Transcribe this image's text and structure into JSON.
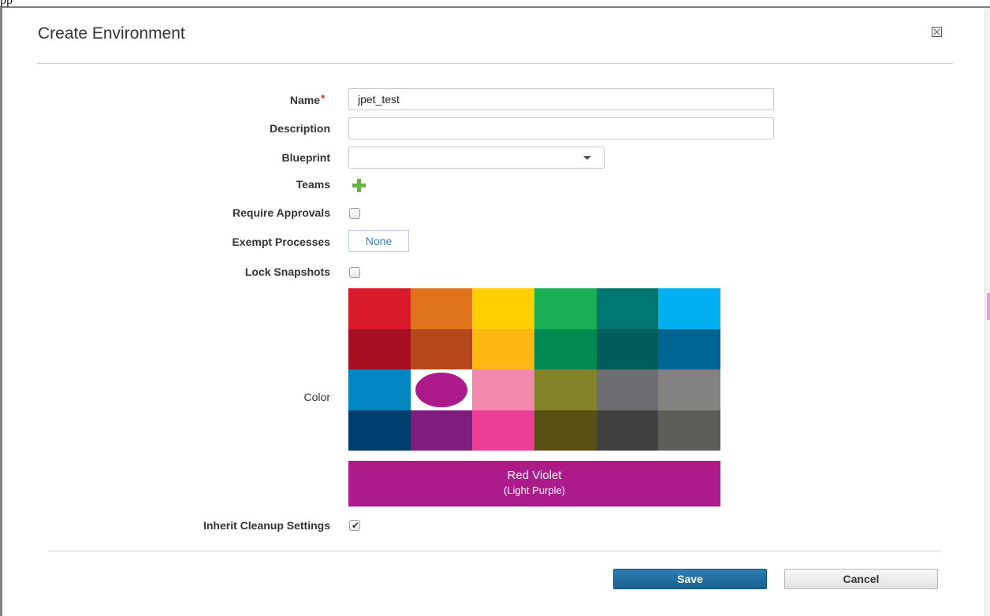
{
  "background_text": "pp",
  "dialog": {
    "title": "Create Environment",
    "close_icon": "close-box-icon"
  },
  "form": {
    "name": {
      "label": "Name",
      "required_mark": "*",
      "value": "jpet_test"
    },
    "description": {
      "label": "Description",
      "value": ""
    },
    "blueprint": {
      "label": "Blueprint",
      "value": ""
    },
    "teams": {
      "label": "Teams",
      "add_icon": "plus-icon"
    },
    "require_approvals": {
      "label": "Require Approvals",
      "checked": false
    },
    "exempt_processes": {
      "label": "Exempt Processes",
      "button_label": "None"
    },
    "lock_snapshots": {
      "label": "Lock Snapshots",
      "checked": false
    },
    "color": {
      "label": "Color",
      "swatches": [
        "#d91a2a",
        "#de7319",
        "#ffcf00",
        "#1aaf54",
        "#007670",
        "#00b0f0",
        "#a60f22",
        "#b5481b",
        "#fdb813",
        "#008a52",
        "#005e5a",
        "#006592",
        "#0087c2",
        "#ad1a8c",
        "#f389ad",
        "#838329",
        "#6d6e71",
        "#838280",
        "#003f6d",
        "#7f1c7e",
        "#ee3d96",
        "#594f13",
        "#414142",
        "#5d5c59"
      ],
      "selected_index": 13,
      "selected_name": "Red Violet",
      "selected_subname": "(Light Purple)",
      "selected_hex": "#ad1a8c"
    },
    "inherit_cleanup": {
      "label": "Inherit Cleanup Settings",
      "checked": true,
      "check_glyph": "✔"
    }
  },
  "buttons": {
    "save": "Save",
    "cancel": "Cancel"
  },
  "colors": {
    "save_button": "#1f6a9e",
    "link": "#2e86c8",
    "add_icon": "#6bb33b"
  }
}
